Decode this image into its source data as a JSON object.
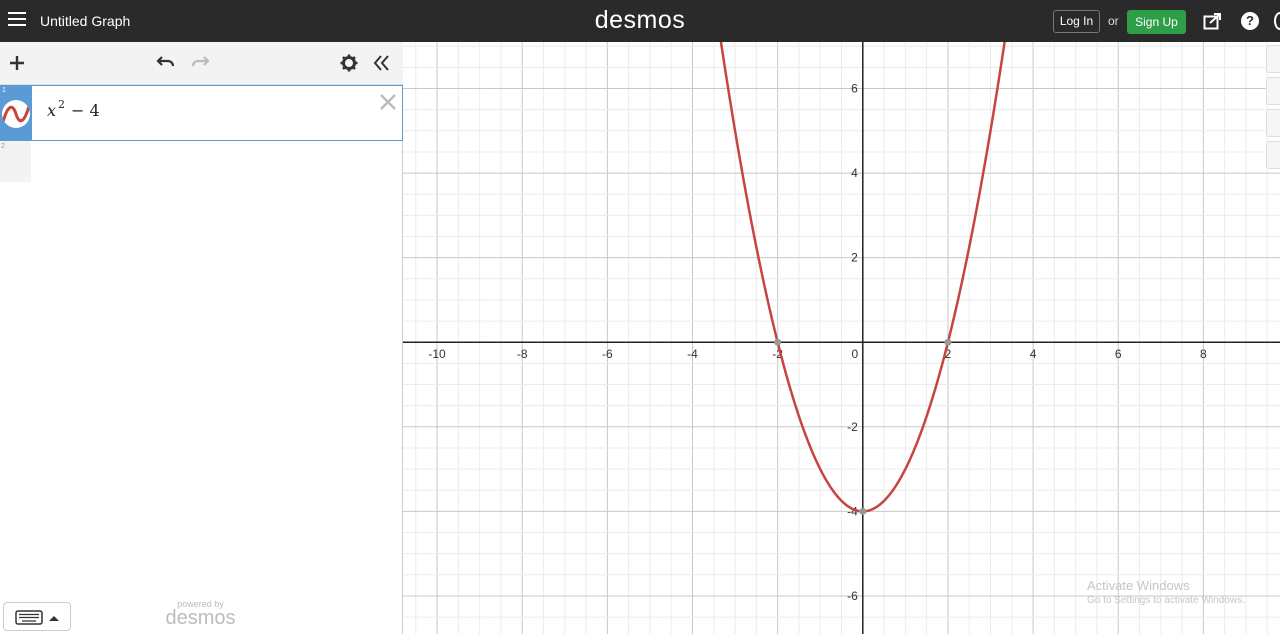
{
  "topbar": {
    "title": "Untitled Graph",
    "logo": "desmos",
    "login_label": "Log In",
    "or_label": "or",
    "signup_label": "Sign Up",
    "help_label": "?",
    "signup_color": "#2e9e48"
  },
  "sidebar": {
    "expressions": [
      {
        "number": "1",
        "base": "x",
        "exponent": "2",
        "rest": "− 4",
        "color": "#c74440"
      },
      {
        "number": "2"
      }
    ],
    "icons": [
      "plus-icon",
      "undo-icon",
      "redo-icon",
      "gear-icon",
      "collapse-icon"
    ],
    "keyboard_icon": "keyboard-icon",
    "powered_by": "powered by",
    "powered_logo": "desmos"
  },
  "graph": {
    "x_ticks": [
      "-10",
      "-8",
      "-6",
      "-4",
      "-2",
      "0",
      "2",
      "4",
      "6",
      "8"
    ],
    "y_ticks": [
      "6",
      "4",
      "2",
      "-2",
      "-4",
      "-6"
    ],
    "curve_color": "#c74440",
    "xlim": [
      -10.8,
      9.8
    ],
    "ylim": [
      -6.9,
      7.1
    ]
  },
  "watermark": {
    "line1": "Activate Windows",
    "line2": "Go to Settings to activate Windows."
  }
}
